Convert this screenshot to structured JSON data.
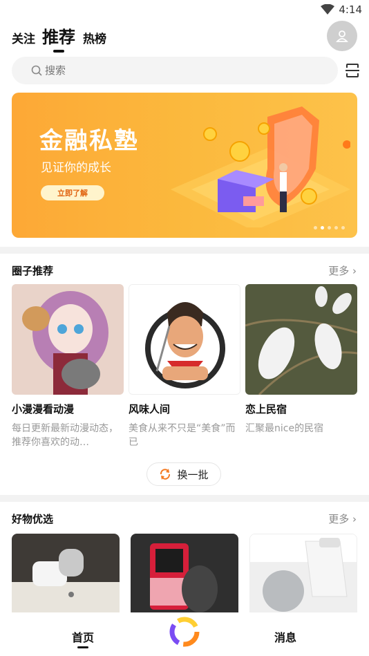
{
  "status": {
    "time": "4:14"
  },
  "top_tabs": {
    "follow": "关注",
    "recommend": "推荐",
    "hot": "热榜"
  },
  "search": {
    "placeholder": "搜索"
  },
  "banner": {
    "title": "金融私塾",
    "subtitle": "见证你的成长",
    "button": "立即了解",
    "page_count": 5,
    "active_page": 2
  },
  "circles": {
    "title": "圈子推荐",
    "more": "更多",
    "items": [
      {
        "title": "小漫漫看动漫",
        "desc": "每日更新最新动漫动态，推荐你喜欢的动…"
      },
      {
        "title": "风味人间",
        "desc": "美食从来不只是“美食”而已"
      },
      {
        "title": "恋上民宿",
        "desc": "汇聚最nice的民宿"
      }
    ],
    "refresh": "换一批"
  },
  "goods": {
    "title": "好物优选",
    "more": "更多"
  },
  "bottom_nav": {
    "home": "首页",
    "messages": "消息"
  },
  "colors": {
    "accent": "#f47a21",
    "banner": "#fbb93d",
    "text_muted": "#999999"
  }
}
